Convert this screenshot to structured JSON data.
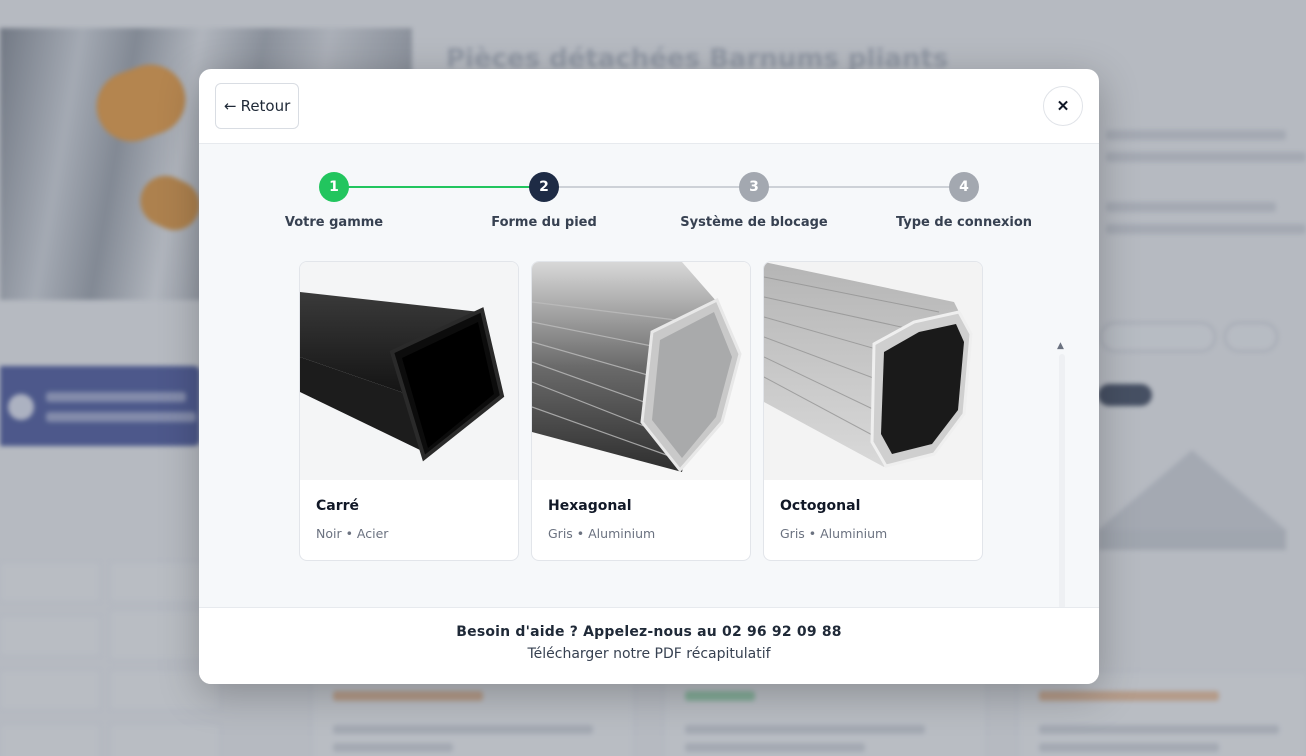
{
  "background": {
    "title": "Pièces détachées Barnums pliants"
  },
  "modal": {
    "back_label": "Retour",
    "back_arrow": "←",
    "close_icon": "✕",
    "steps": [
      {
        "number": "1",
        "label": "Votre gamme",
        "state": "done",
        "color": "#22c55e"
      },
      {
        "number": "2",
        "label": "Forme du pied",
        "state": "active",
        "color": "#1e2b45"
      },
      {
        "number": "3",
        "label": "Système de blocage",
        "state": "upcoming",
        "color": "#a3a8b0"
      },
      {
        "number": "4",
        "label": "Type de connexion",
        "state": "upcoming",
        "color": "#a3a8b0"
      }
    ],
    "options": [
      {
        "title": "Carré",
        "subtitle": "Noir • Acier"
      },
      {
        "title": "Hexagonal",
        "subtitle": "Gris • Aluminium"
      },
      {
        "title": "Octogonal",
        "subtitle": "Gris • Aluminium"
      }
    ],
    "footer": {
      "help_text": "Besoin d'aide ? Appelez-nous au 02 96 92 09 88",
      "pdf_link": "Télécharger notre PDF récapitulatif"
    }
  },
  "colors": {
    "accent_green": "#22c55e",
    "active_navy": "#1e2b45",
    "inactive_gray": "#a3a8b0"
  }
}
